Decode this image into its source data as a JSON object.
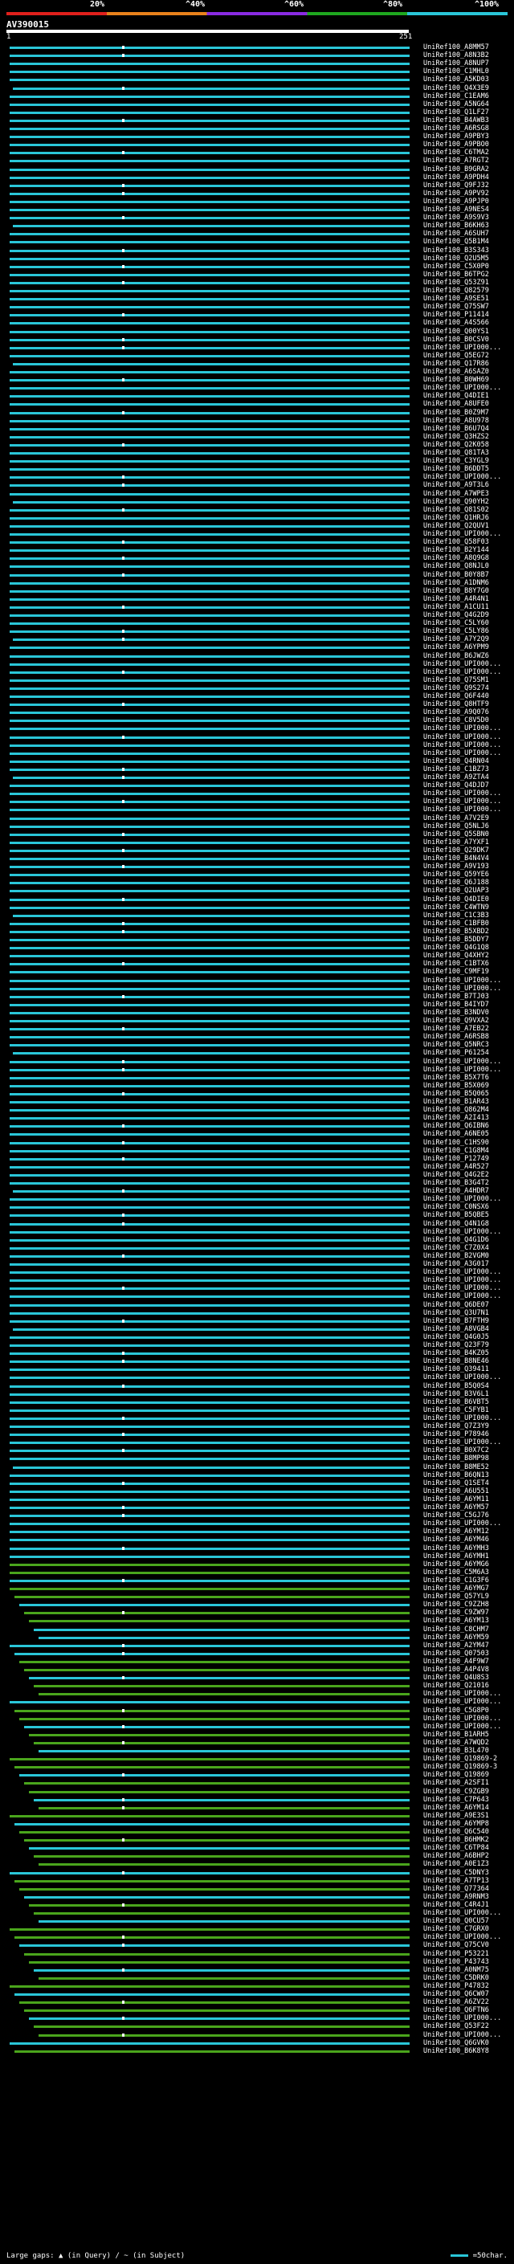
{
  "scale": {
    "labels": [
      "20%",
      "^40%",
      "^60%",
      "^80%",
      "^100%"
    ],
    "colors": [
      "#e0201c",
      "#e8821c",
      "#8a2be2",
      "#1fa81f",
      "#2ac6d8"
    ]
  },
  "query": {
    "name": "AV390015",
    "start": "1",
    "end": "251"
  },
  "hit_colors": {
    "high": "#2ac6d8",
    "mid": "#4aa51c"
  },
  "hits": [
    "UniRef100_A8MM57",
    "UniRef100_A8N3B2",
    "UniRef100_A8NUP7",
    "UniRef100_C1MHL0",
    "UniRef100_A5KD03",
    "UniRef100_Q4X3E9",
    "UniRef100_C1EAM6",
    "UniRef100_A5NG64",
    "UniRef100_Q1LF27",
    "UniRef100_B4AWB3",
    "UniRef100_A6RSG8",
    "UniRef100_A9PBY3",
    "UniRef100_A9PBO0",
    "UniRef100_C6TMA2",
    "UniRef100_A7RGT2",
    "UniRef100_B9GRA2",
    "UniRef100_A9PDH4",
    "UniRef100_Q9FJ32",
    "UniRef100_A9PV92",
    "UniRef100_A9PJP0",
    "UniRef100_A9NES4",
    "UniRef100_A9S9V3",
    "UniRef100_B6KH63",
    "UniRef100_A6SUH7",
    "UniRef100_Q5B1M4",
    "UniRef100_B3S343",
    "UniRef100_Q2U5M5",
    "UniRef100_C5X0P0",
    "UniRef100_B6TPG2",
    "UniRef100_Q53Z91",
    "UniRef100_Q82579",
    "UniRef100_A9SE51",
    "UniRef100_Q75SW7",
    "UniRef100_P11414",
    "UniRef100_A4S566",
    "UniRef100_Q00YS1",
    "UniRef100_B0CSV0",
    "UniRef100_UPI000...",
    "UniRef100_Q5EG72",
    "UniRef100_Q17R86",
    "UniRef100_A6SAZ0",
    "UniRef100_B0WH69",
    "UniRef100_UPI000...",
    "UniRef100_Q4DIE1",
    "UniRef100_A8UFE0",
    "UniRef100_B0Z9M7",
    "UniRef100_A8U978",
    "UniRef100_B6U7Q4",
    "UniRef100_Q3HZS2",
    "UniRef100_Q2K058",
    "UniRef100_Q81TA3",
    "UniRef100_C3YGL9",
    "UniRef100_B6DDT5",
    "UniRef100_UPI000...",
    "UniRef100_A9T3L6",
    "UniRef100_A7WPE3",
    "UniRef100_Q90YH2",
    "UniRef100_Q81S02",
    "UniRef100_Q1HRJ6",
    "UniRef100_Q2QUV1",
    "UniRef100_UPI000...",
    "UniRef100_Q58F03",
    "UniRef100_B2Y144",
    "UniRef100_A8Q9G8",
    "UniRef100_Q8NJL0",
    "UniRef100_B0Y8B7",
    "UniRef100_A1DNM6",
    "UniRef100_B8Y7G0",
    "UniRef100_A4R4N1",
    "UniRef100_A1CU11",
    "UniRef100_Q4G2D9",
    "UniRef100_C5LY60",
    "UniRef100_C5LY86",
    "UniRef100_A7Y2Q9",
    "UniRef100_A6YPM9",
    "UniRef100_B6JWZ6",
    "UniRef100_UPI000...",
    "UniRef100_UPI000...",
    "UniRef100_Q75SM1",
    "UniRef100_Q9S274",
    "UniRef100_Q6F440",
    "UniRef100_Q8HTF9",
    "UniRef100_A9Q076",
    "UniRef100_C8V5D0",
    "UniRef100_UPI000...",
    "UniRef100_UPI000...",
    "UniRef100_UPI000...",
    "UniRef100_UPI000...",
    "UniRef100_Q4RN04",
    "UniRef100_C1BZ73",
    "UniRef100_A9ZTA4",
    "UniRef100_Q4DJD7",
    "UniRef100_UPI000...",
    "UniRef100_UPI000...",
    "UniRef100_UPI000...",
    "UniRef100_A7V2E9",
    "UniRef100_Q5NLJ6",
    "UniRef100_Q5SBN0",
    "UniRef100_A7YXF1",
    "UniRef100_Q29DK7",
    "UniRef100_B4N4V4",
    "UniRef100_A9V193",
    "UniRef100_Q59YE6",
    "UniRef100_Q6J188",
    "UniRef100_Q2UAP3",
    "UniRef100_Q4DIE0",
    "UniRef100_C4WTN9",
    "UniRef100_C1C3B3",
    "UniRef100_C1BFB0",
    "UniRef100_B5XBD2",
    "UniRef100_B5DDY7",
    "UniRef100_Q4G1Q8",
    "UniRef100_Q4XHY2",
    "UniRef100_C1BTX6",
    "UniRef100_C9MF19",
    "UniRef100_UPI000...",
    "UniRef100_UPI000...",
    "UniRef100_B7TJ03",
    "UniRef100_B4IYD7",
    "UniRef100_B3NDV0",
    "UniRef100_Q9VXA2",
    "UniRef100_A7EB22",
    "UniRef100_A6RSB8",
    "UniRef100_Q5NRC3",
    "UniRef100_P61254",
    "UniRef100_UPI000...",
    "UniRef100_UPI000...",
    "UniRef100_B5X7T6",
    "UniRef100_B5X069",
    "UniRef100_B5Q065",
    "UniRef100_B1AR43",
    "UniRef100_Q862M4",
    "UniRef100_A2I413",
    "UniRef100_Q6IBN6",
    "UniRef100_A6NE05",
    "UniRef100_C1HS90",
    "UniRef100_C1G8M4",
    "UniRef100_P12749",
    "UniRef100_A4R527",
    "UniRef100_Q4G2E2",
    "UniRef100_B3G4T2",
    "UniRef100_A4HDR7",
    "UniRef100_UPI000...",
    "UniRef100_C0NSX6",
    "UniRef100_B5QBE5",
    "UniRef100_Q4N1G8",
    "UniRef100_UPI000...",
    "UniRef100_Q4G1D6",
    "UniRef100_C7Z0X4",
    "UniRef100_B2VGM0",
    "UniRef100_A3G017",
    "UniRef100_UPI000...",
    "UniRef100_UPI000...",
    "UniRef100_UPI000...",
    "UniRef100_UPI000...",
    "UniRef100_Q6DE07",
    "UniRef100_Q3U7N1",
    "UniRef100_B7FTH9",
    "UniRef100_A8VGB4",
    "UniRef100_Q4G0J5",
    "UniRef100_Q23F79",
    "UniRef100_B4KZ05",
    "UniRef100_B8NE46",
    "UniRef100_Q39411",
    "UniRef100_UPI000...",
    "UniRef100_B5Q0S4",
    "UniRef100_B3V6L1",
    "UniRef100_B6VBT5",
    "UniRef100_C5FYB1",
    "UniRef100_UPI000...",
    "UniRef100_Q7Z3Y9",
    "UniRef100_P78946",
    "UniRef100_UPI000...",
    "UniRef100_B0X7C2",
    "UniRef100_B8MP98",
    "UniRef100_B8ME52",
    "UniRef100_B6QN13",
    "UniRef100_Q1SET4",
    "UniRef100_A6U551",
    "UniRef100_A6YM11",
    "UniRef100_A6YM57",
    "UniRef100_C5GJ76",
    "UniRef100_UPI000...",
    "UniRef100_A6YM12",
    "UniRef100_A6YM46",
    "UniRef100_A6YMH3",
    "UniRef100_A6YMH1",
    "UniRef100_A6YMG6",
    "UniRef100_C5M6A3",
    "UniRef100_C1G3F6",
    "UniRef100_A6YMG7",
    "UniRef100_Q57YL9",
    "UniRef100_C9ZZH8",
    "UniRef100_C9ZW97",
    "UniRef100_A6YM13",
    "UniRef100_C8CHM7",
    "UniRef100_A6YM59",
    "UniRef100_A2YM47",
    "UniRef100_Q07503",
    "UniRef100_A4F9W7",
    "UniRef100_A4P4V8",
    "UniRef100_Q4U8S3",
    "UniRef100_Q21016",
    "UniRef100_UPI000...",
    "UniRef100_UPI000...",
    "UniRef100_C5G8P0",
    "UniRef100_UPI000...",
    "UniRef100_UPI000...",
    "UniRef100_B1ARH5",
    "UniRef100_A7WQD2",
    "UniRef100_B3L470",
    "UniRef100_Q19869-2",
    "UniRef100_Q19869-3",
    "UniRef100_Q19869",
    "UniRef100_A2SFI1",
    "UniRef100_C9ZGB9",
    "UniRef100_C7P643",
    "UniRef100_A6YM14",
    "UniRef100_A9E3S1",
    "UniRef100_A6YMP8",
    "UniRef100_Q6C540",
    "UniRef100_B6HMK2",
    "UniRef100_C6TP84",
    "UniRef100_A6BHP2",
    "UniRef100_A0E1Z3",
    "UniRef100_C5DNY3",
    "UniRef100_A7TP13",
    "UniRef100_Q77364",
    "UniRef100_A9RNM3",
    "UniRef100_C4R4J1",
    "UniRef100_UPI000...",
    "UniRef100_Q0CU57",
    "UniRef100_C7GRX0",
    "UniRef100_UPI000...",
    "UniRef100_Q75CV0",
    "UniRef100_P53221",
    "UniRef100_P43743",
    "UniRef100_A0NM75",
    "UniRef100_C5DRK0",
    "UniRef100_P47832",
    "UniRef100_Q6CW07",
    "UniRef100_A6ZV22",
    "UniRef100_Q6FTN6",
    "UniRef100_UPI000...",
    "UniRef100_Q53F22",
    "UniRef100_UPI000...",
    "UniRef100_Q6GVK0",
    "UniRef100_B6K8Y8"
  ],
  "legend": {
    "left": "Large gaps: ▲ (in Query) / ~ (in Subject)",
    "right": "=50char."
  }
}
